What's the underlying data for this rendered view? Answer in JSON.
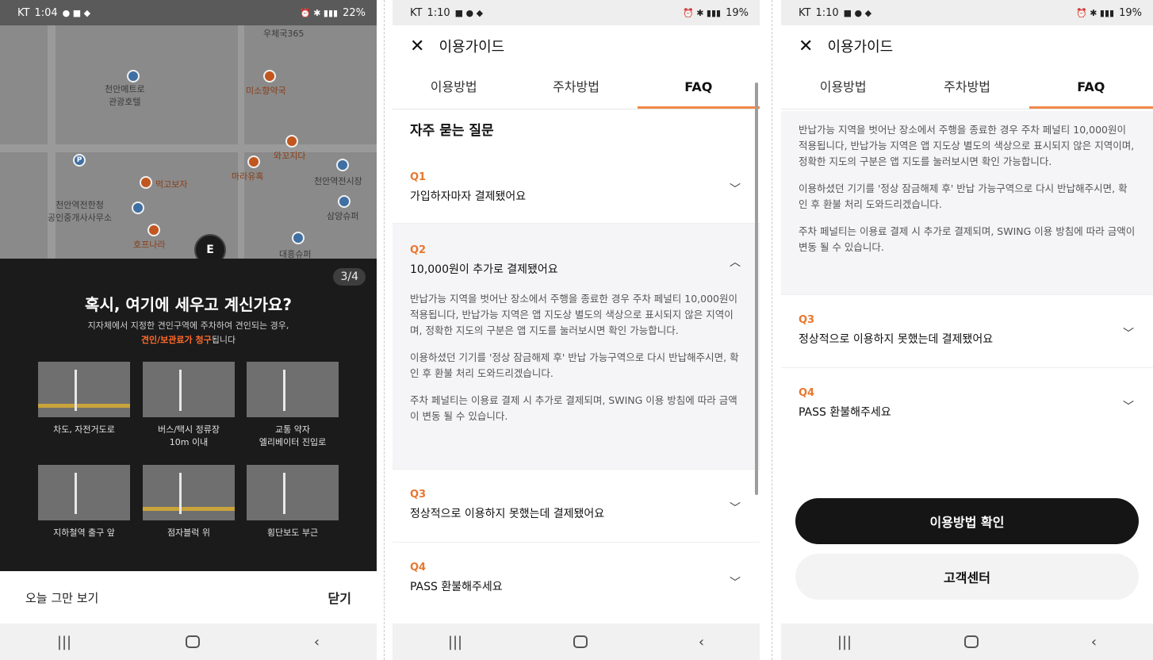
{
  "panel1": {
    "status": {
      "carrier": "KT",
      "time": "1:04",
      "battery": "22%"
    },
    "map_labels": [
      "우체국365",
      "천안메트로\n관광호텔",
      "미소향약국",
      "와꼬지다",
      "마라유혹",
      "먹고보자",
      "천안역전시장",
      "천안역전한청\n공인중개사사무소",
      "삼양슈퍼",
      "호프나라",
      "대흥슈퍼"
    ],
    "pager": "3/4",
    "title": "혹시, 여기에 세우고 계신가요?",
    "subtitle_line1": "지자체에서 지정한 견인구역에 주차하여 견인되는 경우,",
    "subtitle_highlight": "견인/보관료가 청구",
    "subtitle_tail": "됩니다",
    "tiles": [
      {
        "caption": "차도, 자전거도로"
      },
      {
        "caption": "버스/택시 정류장\n10m 이내"
      },
      {
        "caption": "교통 약자\n엘리베이터 진입로"
      },
      {
        "caption": "지하철역 출구 앞"
      },
      {
        "caption": "점자블럭 위"
      },
      {
        "caption": "횡단보도 부근"
      }
    ],
    "footer": {
      "dismiss_today": "오늘 그만 보기",
      "close": "닫기"
    }
  },
  "panel2": {
    "status": {
      "carrier": "KT",
      "time": "1:10",
      "battery": "19%"
    },
    "header_title": "이용가이드",
    "tabs": [
      "이용방법",
      "주차방법",
      "FAQ"
    ],
    "section_title": "자주 묻는 질문",
    "faqs": [
      {
        "no": "Q1",
        "q": "가입하자마자 결제됐어요"
      },
      {
        "no": "Q2",
        "q": "10,000원이 추가로 결제됐어요"
      },
      {
        "no": "Q3",
        "q": "정상적으로 이용하지 못했는데 결제됐어요"
      },
      {
        "no": "Q4",
        "q": "PASS 환불해주세요"
      }
    ],
    "answer": [
      "반납가능 지역을 벗어난 장소에서 주행을 종료한 경우 주차 페널티 10,000원이 적용됩니다, 반납가능 지역은 앱 지도상 별도의 색상으로 표시되지 않은 지역이며, 정확한 지도의 구분은 앱 지도를 눌러보시면 확인 가능합니다.",
      "이용하셨던 기기를 '정상 잠금해제 후' 반납 가능구역으로 다시 반납해주시면, 확인 후 환불 처리 도와드리겠습니다.",
      "주차 페널티는 이용료 결제 시 추가로 결제되며, SWING 이용 방침에 따라 금액이 변동 될 수 있습니다."
    ]
  },
  "panel3": {
    "status": {
      "carrier": "KT",
      "time": "1:10",
      "battery": "19%"
    },
    "buttons": {
      "how_to_use": "이용방법 확인",
      "customer_center": "고객센터"
    }
  },
  "icons": {
    "close": "close-icon",
    "chevron_down": "chevron-down-icon",
    "chevron_up": "chevron-up-icon"
  },
  "colors": {
    "accent": "#e8772e",
    "highlight": "#ff6a2a",
    "dark": "#151515"
  }
}
